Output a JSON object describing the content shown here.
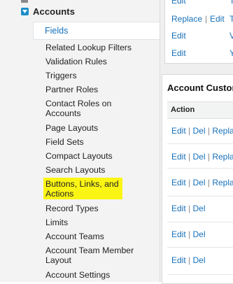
{
  "sidebar": {
    "section_title": "Accounts",
    "selected_item": "Fields",
    "items": [
      {
        "label": "Related Lookup Filters"
      },
      {
        "label": "Validation Rules"
      },
      {
        "label": "Triggers"
      },
      {
        "label": "Partner Roles"
      },
      {
        "label": "Contact Roles on Accounts"
      },
      {
        "label": "Page Layouts"
      },
      {
        "label": "Field Sets"
      },
      {
        "label": "Compact Layouts"
      },
      {
        "label": "Search Layouts"
      },
      {
        "label": "Buttons, Links, and Actions",
        "highlighted": true
      },
      {
        "label": "Record Types"
      },
      {
        "label": "Limits"
      },
      {
        "label": "Account Teams"
      },
      {
        "label": "Account Team Member Layout"
      },
      {
        "label": "Account Settings"
      }
    ],
    "highlight_color": "#fbf514"
  },
  "top_panel": {
    "rows": [
      {
        "edit": "Edit",
        "extra": "T"
      },
      {
        "replace": "Replace",
        "sep": "|",
        "edit": "Edit",
        "extra": "T"
      },
      {
        "edit": "Edit",
        "extra": "V"
      },
      {
        "edit": "Edit",
        "extra": "Y"
      }
    ]
  },
  "custom_buttons_panel": {
    "title": "Account Custom Buttons, Links, and Actions",
    "column_action": "Action",
    "rows": [
      {
        "edit": "Edit",
        "sep1": "|",
        "del": "Del",
        "sep2": "|",
        "replace": "Replace"
      },
      {
        "edit": "Edit",
        "sep1": "|",
        "del": "Del",
        "sep2": "|",
        "replace": "Replace"
      },
      {
        "edit": "Edit",
        "sep1": "|",
        "del": "Del",
        "sep2": "|",
        "replace": "Replace"
      },
      {
        "edit": "Edit",
        "sep1": "|",
        "del": "Del"
      },
      {
        "edit": "Edit",
        "sep1": "|",
        "del": "Del"
      },
      {
        "edit": "Edit",
        "sep1": "|",
        "del": "Del"
      }
    ]
  },
  "colors": {
    "link": "#1670b9",
    "toggle": "#1c8ec9"
  }
}
